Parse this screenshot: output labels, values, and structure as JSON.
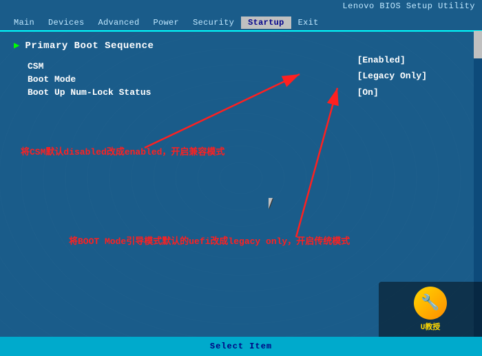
{
  "bios": {
    "title": "Lenovo BIOS Setup Utility",
    "menu_items": [
      {
        "id": "main",
        "label": "Main"
      },
      {
        "id": "devices",
        "label": "Devices"
      },
      {
        "id": "advanced",
        "label": "Advanced"
      },
      {
        "id": "power",
        "label": "Power"
      },
      {
        "id": "security",
        "label": "Security"
      },
      {
        "id": "startup",
        "label": "Startup"
      },
      {
        "id": "exit",
        "label": "Exit"
      }
    ],
    "active_tab": "Startup",
    "section": {
      "title": "Primary Boot Sequence",
      "settings": [
        {
          "name": "CSM",
          "value": "[Enabled]"
        },
        {
          "name": "Boot Mode",
          "value": "[Legacy Only]"
        },
        {
          "name": "Boot Up Num-Lock Status",
          "value": "[On]"
        }
      ]
    },
    "annotations": {
      "text1": "将CSM默认disabled改成enabled，开启兼容模式",
      "text2": "将BOOT Mode引导模式默认的uefi改成legacy only，开启传统模式"
    },
    "bottom_bar": "Select Item"
  }
}
